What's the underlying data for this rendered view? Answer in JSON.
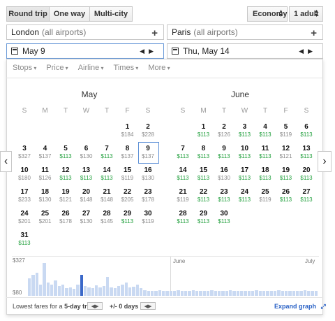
{
  "trip_type": {
    "options": [
      "Round trip",
      "One way",
      "Multi-city"
    ],
    "selected": "Round trip"
  },
  "cabin": {
    "label": "Economy"
  },
  "passengers": {
    "label": "1 adult"
  },
  "origin": {
    "city": "London",
    "detail": "(all airports)"
  },
  "destination": {
    "city": "Paris",
    "detail": "(all airports)"
  },
  "depart_date": "May 9",
  "return_date": "Thu, May 14",
  "filters": [
    "Stops",
    "Price",
    "Airline",
    "Times",
    "More"
  ],
  "weekdays": [
    "S",
    "M",
    "T",
    "W",
    "T",
    "F",
    "S"
  ],
  "may": {
    "title": "May",
    "days": [
      {
        "d": "1",
        "p": "$184",
        "g": false
      },
      {
        "d": "2",
        "p": "$228",
        "g": false
      },
      {
        "d": "3",
        "p": "$327",
        "g": false
      },
      {
        "d": "4",
        "p": "$137",
        "g": false
      },
      {
        "d": "5",
        "p": "$113",
        "g": true
      },
      {
        "d": "6",
        "p": "$130",
        "g": false
      },
      {
        "d": "7",
        "p": "$113",
        "g": true
      },
      {
        "d": "8",
        "p": "$137",
        "g": false
      },
      {
        "d": "9",
        "p": "$137",
        "g": false
      },
      {
        "d": "10",
        "p": "$180",
        "g": false
      },
      {
        "d": "11",
        "p": "$126",
        "g": false
      },
      {
        "d": "12",
        "p": "$113",
        "g": true
      },
      {
        "d": "13",
        "p": "$113",
        "g": true
      },
      {
        "d": "14",
        "p": "$113",
        "g": true
      },
      {
        "d": "15",
        "p": "$119",
        "g": false
      },
      {
        "d": "16",
        "p": "$130",
        "g": false
      },
      {
        "d": "17",
        "p": "$233",
        "g": false
      },
      {
        "d": "18",
        "p": "$130",
        "g": false
      },
      {
        "d": "19",
        "p": "$121",
        "g": false
      },
      {
        "d": "20",
        "p": "$148",
        "g": false
      },
      {
        "d": "21",
        "p": "$148",
        "g": false
      },
      {
        "d": "22",
        "p": "$205",
        "g": false
      },
      {
        "d": "23",
        "p": "$178",
        "g": false
      },
      {
        "d": "24",
        "p": "$201",
        "g": false
      },
      {
        "d": "25",
        "p": "$201",
        "g": false
      },
      {
        "d": "26",
        "p": "$178",
        "g": false
      },
      {
        "d": "27",
        "p": "$130",
        "g": false
      },
      {
        "d": "28",
        "p": "$145",
        "g": false
      },
      {
        "d": "29",
        "p": "$113",
        "g": true
      },
      {
        "d": "30",
        "p": "$119",
        "g": false
      },
      {
        "d": "31",
        "p": "$113",
        "g": true
      }
    ]
  },
  "june": {
    "title": "June",
    "days": [
      {
        "d": "1",
        "p": "$113",
        "g": true
      },
      {
        "d": "2",
        "p": "$126",
        "g": false
      },
      {
        "d": "3",
        "p": "$113",
        "g": true
      },
      {
        "d": "4",
        "p": "$113",
        "g": true
      },
      {
        "d": "5",
        "p": "$119",
        "g": false
      },
      {
        "d": "6",
        "p": "$113",
        "g": true
      },
      {
        "d": "7",
        "p": "$113",
        "g": true
      },
      {
        "d": "8",
        "p": "$113",
        "g": true
      },
      {
        "d": "9",
        "p": "$113",
        "g": true
      },
      {
        "d": "10",
        "p": "$113",
        "g": true
      },
      {
        "d": "11",
        "p": "$113",
        "g": true
      },
      {
        "d": "12",
        "p": "$121",
        "g": false
      },
      {
        "d": "13",
        "p": "$113",
        "g": true
      },
      {
        "d": "14",
        "p": "$113",
        "g": true
      },
      {
        "d": "15",
        "p": "$113",
        "g": true
      },
      {
        "d": "16",
        "p": "$130",
        "g": false
      },
      {
        "d": "17",
        "p": "$113",
        "g": true
      },
      {
        "d": "18",
        "p": "$113",
        "g": true
      },
      {
        "d": "19",
        "p": "$113",
        "g": true
      },
      {
        "d": "20",
        "p": "$113",
        "g": true
      },
      {
        "d": "21",
        "p": "$119",
        "g": false
      },
      {
        "d": "22",
        "p": "$113",
        "g": true
      },
      {
        "d": "23",
        "p": "$113",
        "g": true
      },
      {
        "d": "24",
        "p": "$113",
        "g": true
      },
      {
        "d": "25",
        "p": "$119",
        "g": false
      },
      {
        "d": "26",
        "p": "$113",
        "g": true
      },
      {
        "d": "27",
        "p": "$113",
        "g": true
      },
      {
        "d": "28",
        "p": "$113",
        "g": true
      },
      {
        "d": "29",
        "p": "$113",
        "g": true
      },
      {
        "d": "30",
        "p": "$113",
        "g": true
      }
    ]
  },
  "graph": {
    "max_label": "$327",
    "min_label": "$80",
    "month_labels": [
      "June",
      "July"
    ],
    "bars": [
      0.45,
      0.55,
      0.6,
      0.3,
      0.85,
      0.35,
      0.3,
      0.4,
      0.25,
      0.3,
      0.2,
      0.22,
      0.18,
      0.3,
      0.55,
      0.25,
      0.22,
      0.2,
      0.28,
      0.22,
      0.25,
      0.5,
      0.22,
      0.2,
      0.25,
      0.3,
      0.35,
      0.22,
      0.24,
      0.3,
      0.2,
      0.15,
      0.12,
      0.12,
      0.12,
      0.14,
      0.12,
      0.12,
      0.12,
      0.12,
      0.14,
      0.12,
      0.12,
      0.12,
      0.14,
      0.12,
      0.12,
      0.12,
      0.12,
      0.14,
      0.12,
      0.12,
      0.12,
      0.12,
      0.14,
      0.12,
      0.12,
      0.12,
      0.12,
      0.12,
      0.12,
      0.14,
      0.12,
      0.12,
      0.12,
      0.12,
      0.12,
      0.14,
      0.12,
      0.12,
      0.12,
      0.12,
      0.12,
      0.12,
      0.14,
      0.12,
      0.12,
      0.12
    ],
    "selected_index": 14
  },
  "footer": {
    "lowest_prefix": "Lowest fares for a",
    "trip_length": "5-day trip",
    "flex": "+/- 0 days",
    "expand": "Expand graph"
  }
}
